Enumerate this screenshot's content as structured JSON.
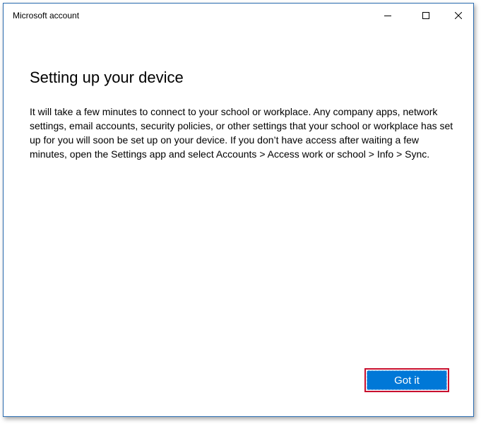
{
  "window": {
    "title": "Microsoft account"
  },
  "titlebar": {
    "minimize_icon": "minimize-icon",
    "maximize_icon": "maximize-icon",
    "close_icon": "close-icon"
  },
  "content": {
    "heading": "Setting up your device",
    "body": "It will take a few minutes to connect to your school or workplace. Any company apps, network settings, email accounts, security policies, or other settings that your school or workplace has set up for you will soon be set up on your device. If you don’t have access after waiting a few minutes, open the Settings app and select Accounts > Access work or school > Info > Sync."
  },
  "actions": {
    "got_it_label": "Got it"
  },
  "colors": {
    "accent": "#0078d7",
    "highlight_border": "#c8102e",
    "window_border": "#2b6cb0"
  }
}
